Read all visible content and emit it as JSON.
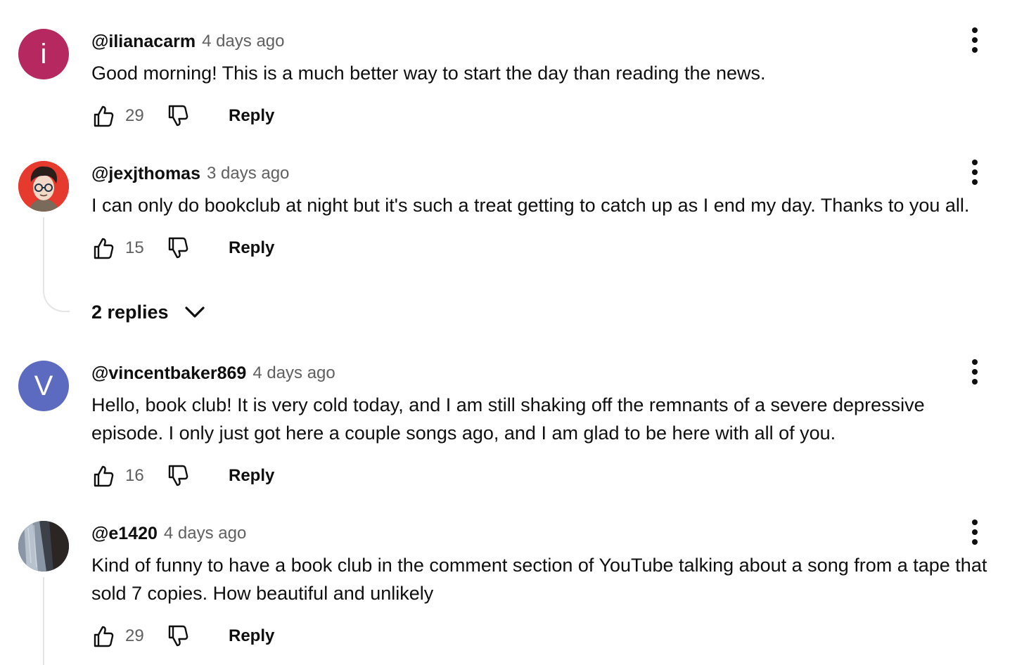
{
  "comments": [
    {
      "author": "@ilianacarm",
      "time": "4 days ago",
      "text": "Good morning! This is a much better way to start the day than reading the news.",
      "likes": "29",
      "reply_label": "Reply",
      "avatar_letter": "i",
      "avatar_color": "#b52860"
    },
    {
      "author": "@jexjthomas",
      "time": "3 days ago",
      "text": "I can only do bookclub at night but it's such a treat getting to catch up as I end my day. Thanks to you all.",
      "likes": "15",
      "reply_label": "Reply",
      "avatar_color": "#e63a2e",
      "replies_label": "2 replies"
    },
    {
      "author": "@vincentbaker869",
      "time": "4 days ago",
      "text": "Hello, book club! It is very cold today, and I am still shaking off the remnants of a severe depressive episode. I only just got here a couple songs ago, and I am glad to be here with all of you.",
      "likes": "16",
      "reply_label": "Reply",
      "avatar_letter": "V",
      "avatar_color": "#5c6bc0"
    },
    {
      "author": "@e1420",
      "time": "4 days ago",
      "text": "Kind of funny to have a book club in the comment section of YouTube talking about a song from a tape that sold 7 copies. How beautiful and unlikely",
      "likes": "29",
      "reply_label": "Reply",
      "avatar_color": "#5a6470"
    }
  ],
  "icons": {
    "like": "thumb-up-icon",
    "dislike": "thumb-down-icon",
    "menu": "more-vert-icon",
    "expand": "chevron-down-icon"
  }
}
